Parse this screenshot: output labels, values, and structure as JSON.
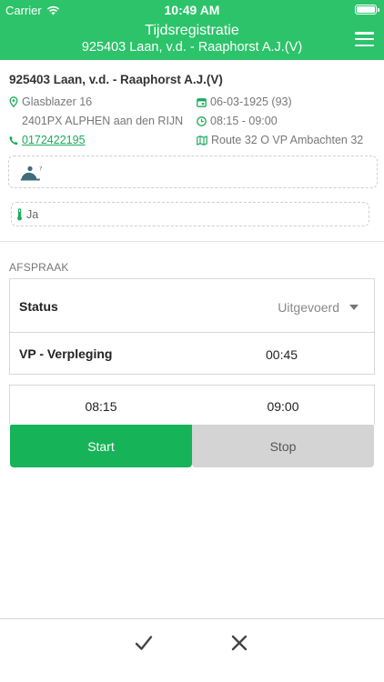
{
  "status_bar": {
    "carrier": "Carrier",
    "time": "10:49 AM"
  },
  "header": {
    "title": "Tijdsregistratie",
    "subtitle": "925403 Laan, v.d. - Raaphorst A.J.(V)",
    "menu_icon": "hamburger-menu-icon"
  },
  "client": {
    "name": "925403 Laan, v.d. - Raaphorst A.J.(V)",
    "street": "Glasblazer 16",
    "postal_city": "2401PX ALPHEN aan den RIJN",
    "phone": "0172422195",
    "birth": "06-03-1925 (93)",
    "time_window": "08:15 - 09:00",
    "route": "Route 32 O VP Ambachten 32"
  },
  "temperature": {
    "value": "Ja"
  },
  "appointment": {
    "section_label": "AFSPRAAK",
    "status_label": "Status",
    "status_value": "Uitgevoerd",
    "service_label": "VP - Verpleging",
    "service_duration": "00:45",
    "start_time": "08:15",
    "end_time": "09:00"
  },
  "actions": {
    "start_label": "Start",
    "stop_label": "Stop"
  },
  "colors": {
    "brand_green": "#2dc36a",
    "start_button": "#17b359",
    "stop_button": "#d4d4d4",
    "link": "#1aab5a"
  }
}
